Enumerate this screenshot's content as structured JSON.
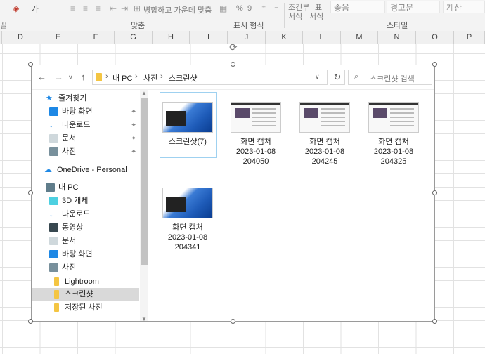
{
  "ribbon": {
    "font_frag": "꼴",
    "font_a": "가",
    "alignment_group": "맞춤",
    "wrap_merge": "병합하고 가운데 맞춤",
    "number_group": "표시 형식",
    "percent": "%",
    "comma": "9",
    "style_group": "스타일",
    "cond_format_1": "조건부",
    "cond_format_2": "서식",
    "table_format_1": "표",
    "table_format_2": "서식",
    "style_good": "좋음",
    "style_warning": "경고문",
    "style_calc": "계산"
  },
  "columns": [
    "D",
    "E",
    "F",
    "G",
    "H",
    "I",
    "J",
    "K",
    "L",
    "M",
    "N",
    "O",
    "P"
  ],
  "explorer": {
    "breadcrumb": [
      "내 PC",
      "사진",
      "스크린샷"
    ],
    "search_placeholder": "스크린샷 검색",
    "sidebar": [
      {
        "label": "즐겨찾기",
        "icon": "star-icon"
      },
      {
        "label": "바탕 화면",
        "icon": "desktop-icon",
        "pinned": true
      },
      {
        "label": "다운로드",
        "icon": "download-icon",
        "pinned": true
      },
      {
        "label": "문서",
        "icon": "document-icon",
        "pinned": true
      },
      {
        "label": "사진",
        "icon": "pictures-icon",
        "pinned": true
      },
      {
        "label": "OneDrive - Personal",
        "icon": "cloud-icon"
      },
      {
        "label": "내 PC",
        "icon": "pc-icon"
      },
      {
        "label": "3D 개체",
        "icon": "cube-icon"
      },
      {
        "label": "다운로드",
        "icon": "download-icon"
      },
      {
        "label": "동영상",
        "icon": "video-icon"
      },
      {
        "label": "문서",
        "icon": "document-icon"
      },
      {
        "label": "바탕 화면",
        "icon": "desktop-icon"
      },
      {
        "label": "사진",
        "icon": "pictures-icon"
      },
      {
        "label": "Lightroom",
        "icon": "folder-icon"
      },
      {
        "label": "스크린샷",
        "icon": "folder-icon",
        "selected": true
      },
      {
        "label": "저장된 사진",
        "icon": "folder-icon"
      }
    ],
    "files": [
      {
        "line1": "스크린샷(7)",
        "line2": "",
        "line3": "",
        "kind": "folder"
      },
      {
        "line1": "화면 캡처",
        "line2": "2023-01-08",
        "line3": "204050",
        "kind": "image"
      },
      {
        "line1": "화면 캡처",
        "line2": "2023-01-08",
        "line3": "204245",
        "kind": "image"
      },
      {
        "line1": "화면 캡처",
        "line2": "2023-01-08",
        "line3": "204325",
        "kind": "image"
      },
      {
        "line1": "화면 캡처",
        "line2": "2023-01-08",
        "line3": "204341",
        "kind": "folder"
      }
    ]
  },
  "colors": {
    "accent": "#0078d4",
    "folder": "#f4c542",
    "selection": "#d9d9d9"
  }
}
